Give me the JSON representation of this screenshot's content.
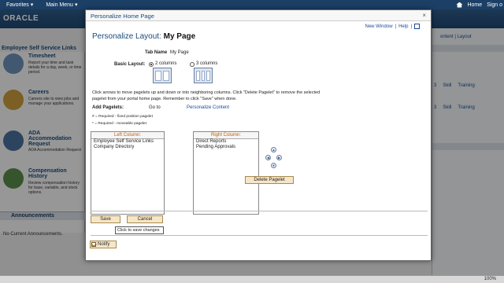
{
  "topbar": {
    "favorites": "Favorites",
    "main_menu": "Main Menu",
    "home": "Home",
    "sign_out": "Sign o"
  },
  "header": {
    "logo": "ORACLE"
  },
  "background": {
    "ess_title": "Employee Self Service Links",
    "ess_items": [
      {
        "title": "Timesheet",
        "desc": "Report your time and task details for a day, week, or time period.",
        "icon": "clock-person-icon"
      },
      {
        "title": "Careers",
        "desc": "Careers site to view jobs and manage your applications.",
        "icon": "careers-icon"
      },
      {
        "title": "ADA Accommodation Request",
        "desc": "ADA Accommodation Request",
        "icon": "wheelchair-icon"
      },
      {
        "title": "Compensation History",
        "desc": "Review compensation history for base, variable, and stock options.",
        "icon": "dollar-icon"
      }
    ],
    "announcements_title": "Announcements",
    "announcements_body": "No Current Announcements.",
    "right_links": "ontent | Layout",
    "right_rows": [
      {
        "n": "3",
        "a": "Skill",
        "b": "Training"
      },
      {
        "n": "3",
        "a": "Skill",
        "b": "Training"
      }
    ],
    "zoom": "100%"
  },
  "modal": {
    "title": "Personalize Home Page",
    "close": "×",
    "links": {
      "new_window": "New Window",
      "help": "Help"
    },
    "heading_prefix": "Personalize Layout:",
    "heading_name": "My Page",
    "tab_name_label": "Tab Name",
    "tab_name_value": "My Page",
    "basic_layout_label": "Basic Layout:",
    "layout_options": [
      {
        "label": "2 columns",
        "selected": true
      },
      {
        "label": "3 columns",
        "selected": false
      }
    ],
    "instructions": "Click arrows to move pagelets up and down or into neighboring columns. Click \"Delete Pagelet\" to remove the selected pagelet from your portal home page. Remember to click \"Save\" when done.",
    "add_pagelets_label": "Add Pagelets:",
    "go_to_label": "Go to",
    "personalize_content_link": "Personalize Content",
    "legend_fixed": "# = Required - fixed position pagelet",
    "legend_moveable": "* = Required - moveable pagelet",
    "left_column": {
      "header": "Left Column:",
      "items": [
        "Employee Self Service Links",
        "Company Directory"
      ]
    },
    "right_column": {
      "header": "Right Column:",
      "items": [
        "Direct Reports",
        "Pending Approvals"
      ]
    },
    "arrows": {
      "up": "▲",
      "left": "◀",
      "right": "▶",
      "down": "▼"
    },
    "delete_button": "Delete Pagelet",
    "save_button": "Save",
    "cancel_button": "Cancel",
    "tooltip": "Click to save changes",
    "notify_button": "Notify"
  }
}
